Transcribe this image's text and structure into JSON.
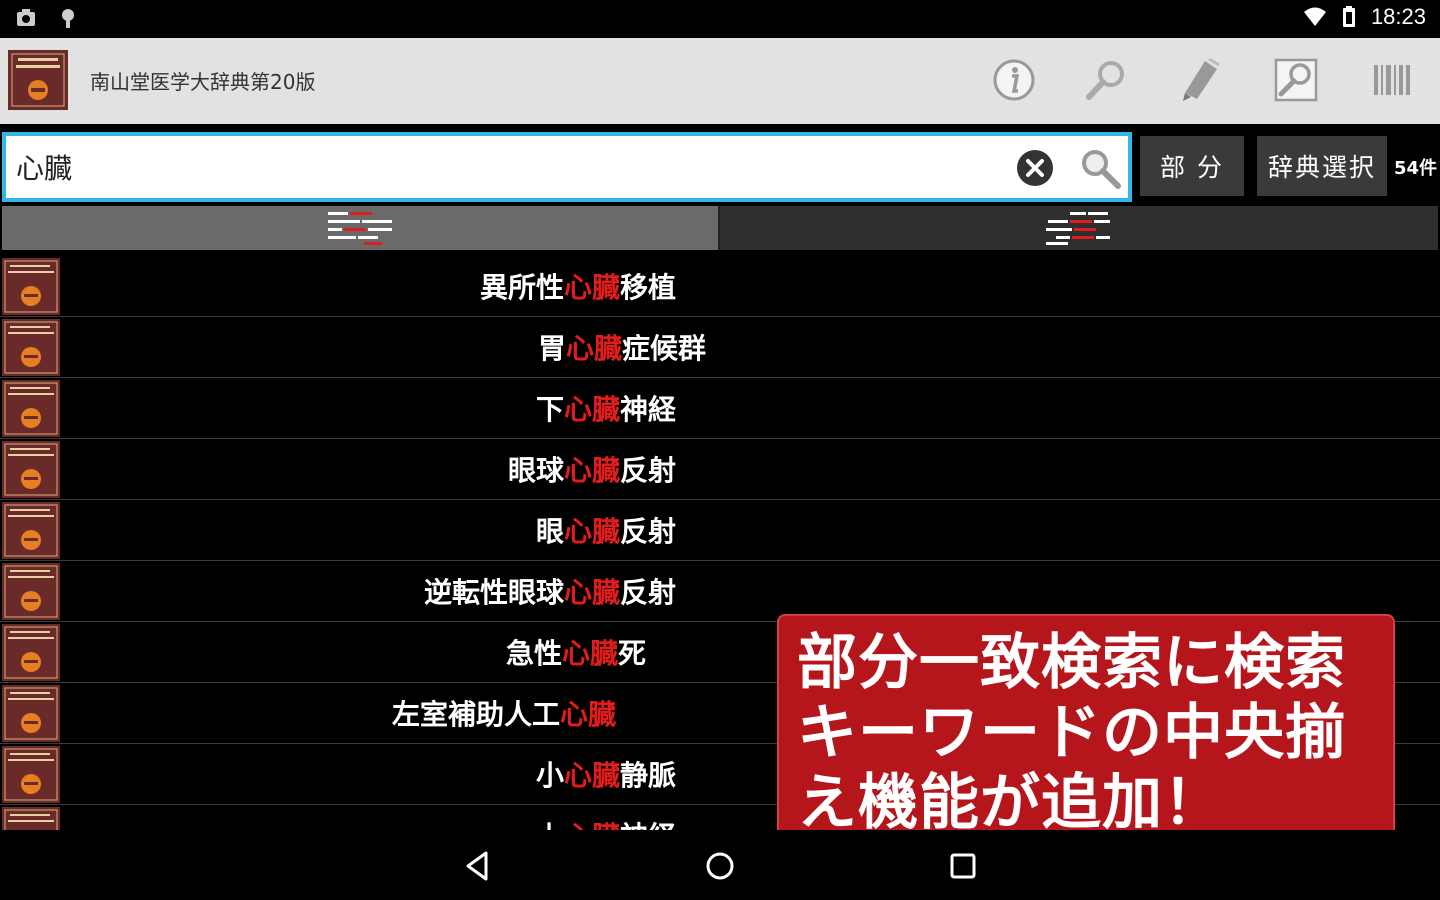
{
  "status_bar": {
    "time": "18:23",
    "icons": [
      "image-notification-icon",
      "android-notification-icon",
      "wifi-icon",
      "battery-icon"
    ]
  },
  "action_bar": {
    "app_title": "南山堂医学大辞典第20版",
    "logo_text": "南山堂 医学大辞典 20",
    "actions": [
      "info-icon",
      "search-icon",
      "marker-icon",
      "zoom-search-icon",
      "barcode-icon"
    ]
  },
  "search": {
    "value": "心臓",
    "partial_button": "部 分",
    "dict_select_button": "辞典選択",
    "count": "54件"
  },
  "tabs": [
    "align-center-icon",
    "align-right-icon"
  ],
  "results": [
    {
      "prefix": "異所性",
      "keyword": "心臓",
      "suffix": "移植"
    },
    {
      "prefix": "胃",
      "keyword": "心臓",
      "suffix": "症候群"
    },
    {
      "prefix": "下",
      "keyword": "心臓",
      "suffix": "神経"
    },
    {
      "prefix": "眼球",
      "keyword": "心臓",
      "suffix": "反射"
    },
    {
      "prefix": "眼",
      "keyword": "心臓",
      "suffix": "反射"
    },
    {
      "prefix": "逆転性眼球",
      "keyword": "心臓",
      "suffix": "反射"
    },
    {
      "prefix": "急性",
      "keyword": "心臓",
      "suffix": "死"
    },
    {
      "prefix": "左室補助人工",
      "keyword": "心臓",
      "suffix": ""
    },
    {
      "prefix": "小",
      "keyword": "心臓",
      "suffix": "静脈"
    },
    {
      "prefix": "上",
      "keyword": "心臓",
      "suffix": "神経"
    }
  ],
  "promo": {
    "line1": "部分一致検索に検索",
    "line2": "キーワードの中央揃",
    "line3": "え機能が追加！"
  },
  "colors": {
    "accent": "#33b5e5",
    "highlight": "#e01c1c",
    "promo_bg": "#b4161c",
    "action_bar_bg": "#e2e2e2"
  }
}
